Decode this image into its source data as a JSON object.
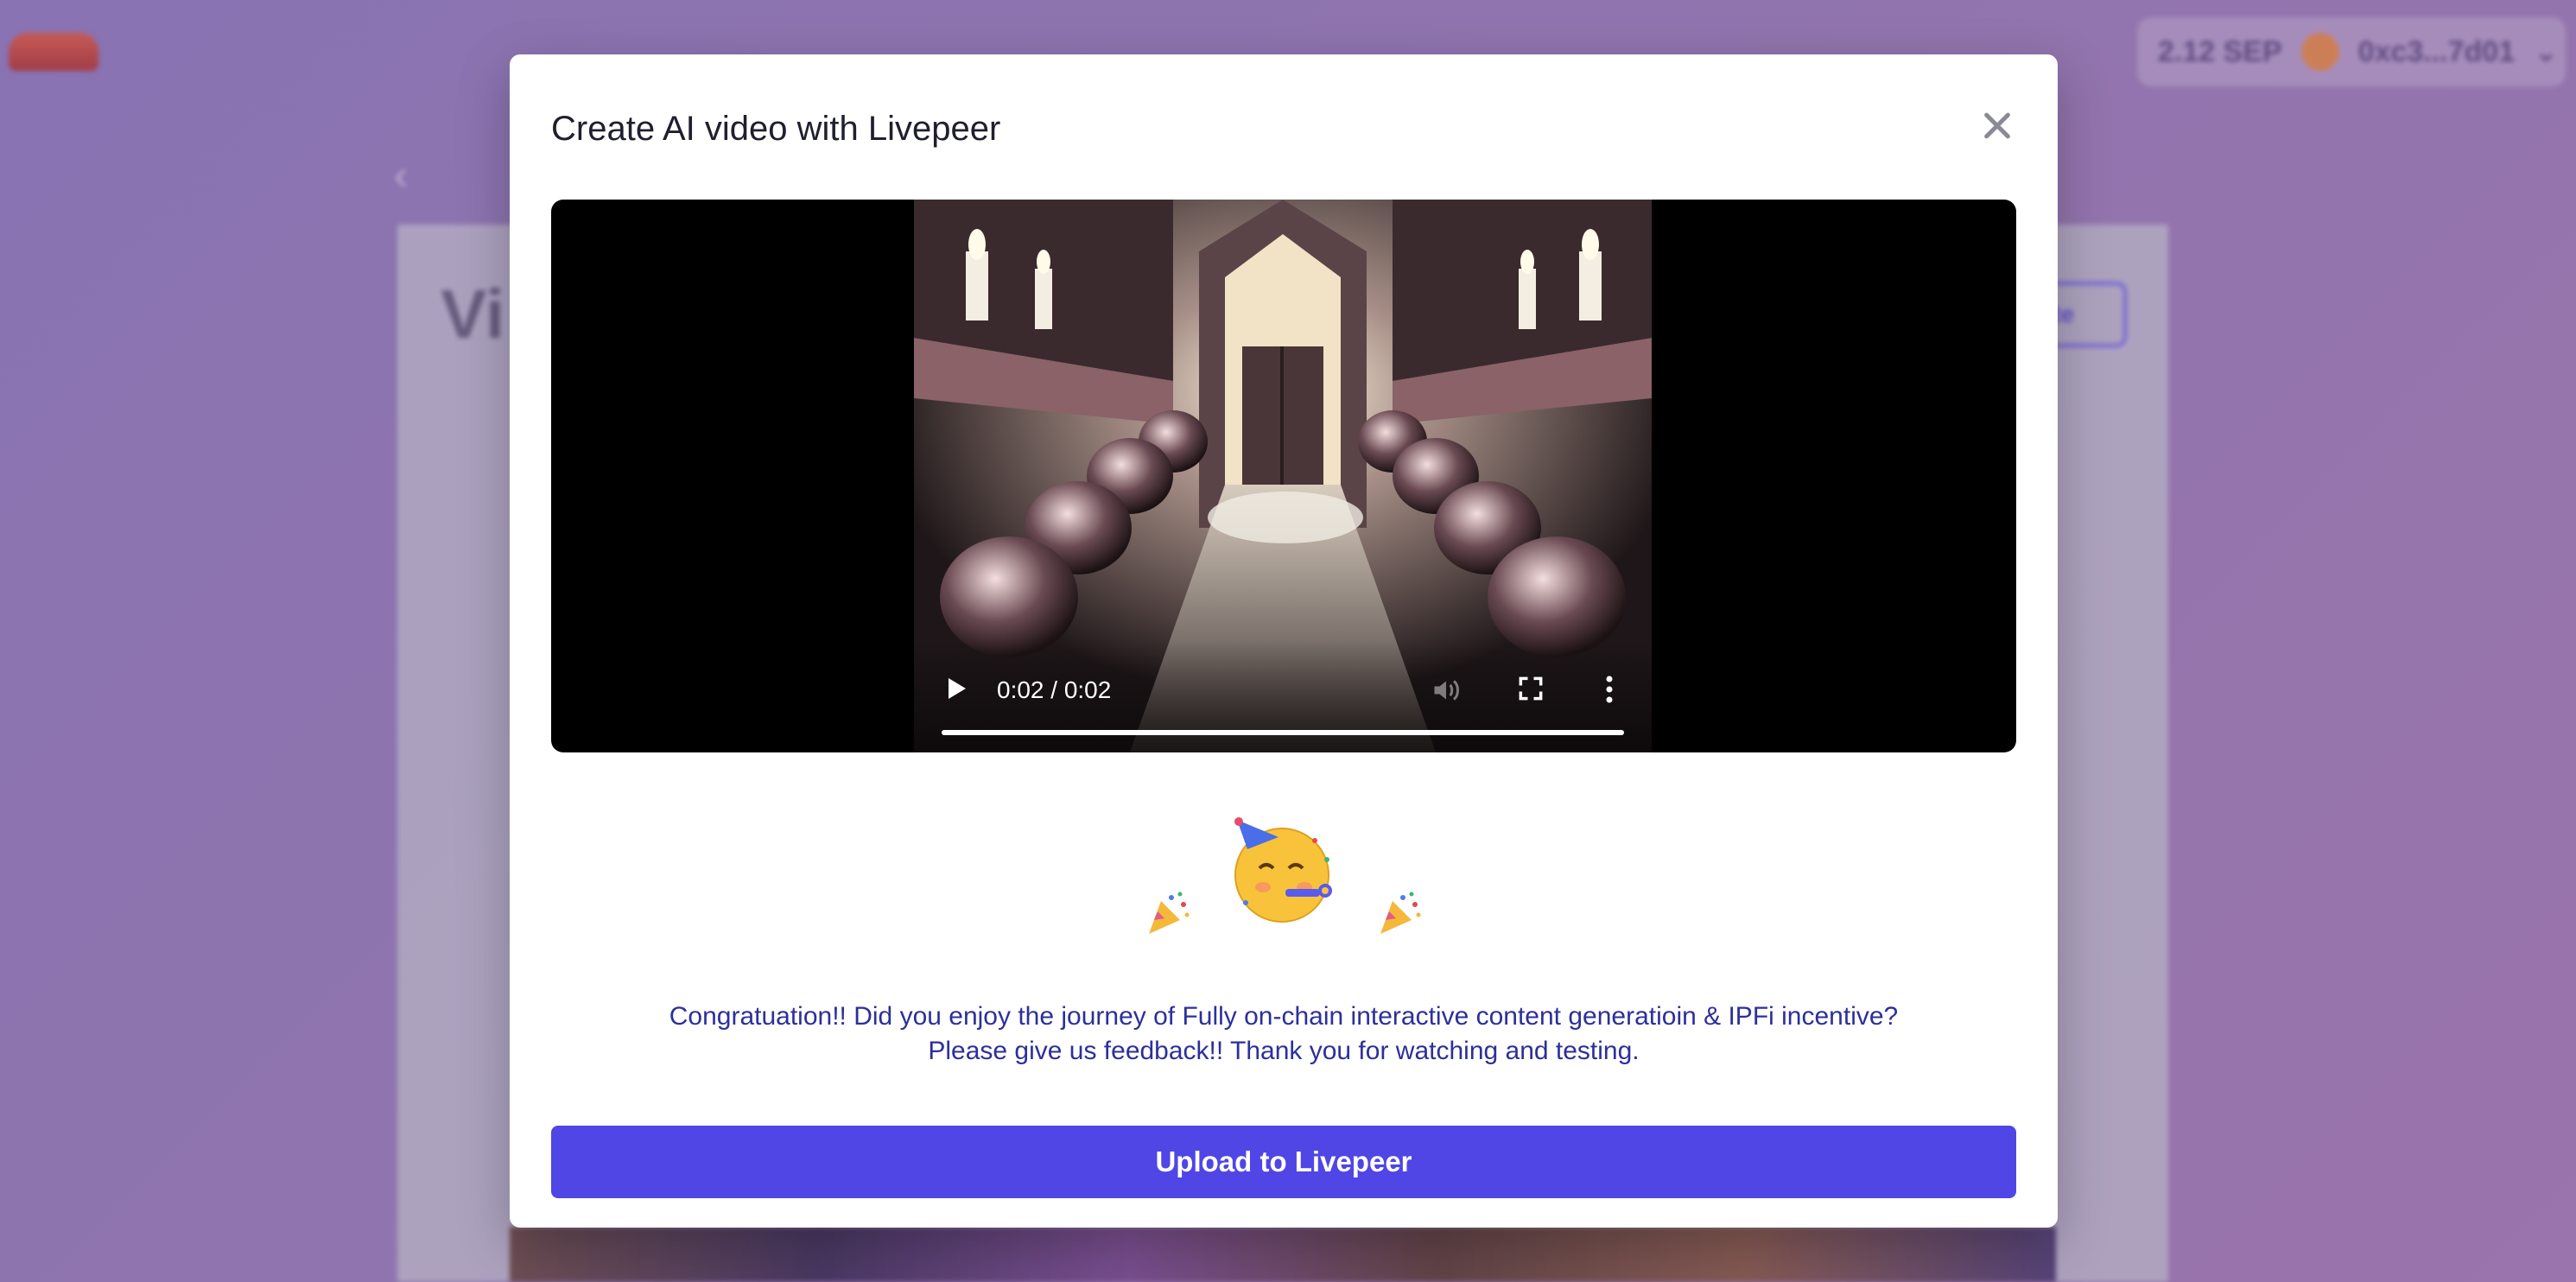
{
  "background": {
    "wallet": {
      "balance": "2.12 SEP",
      "address": "0xc3...7d01"
    },
    "page_title": "Vi",
    "action_button_label": "ate"
  },
  "modal": {
    "title": "Create AI video with Livepeer",
    "video": {
      "time_display": "0:02 / 0:02",
      "progress": 1.0
    },
    "celebration_icons": [
      "face-with-party-horn-icon",
      "party-popper-icon",
      "party-popper-icon"
    ],
    "message": "Congratuation!! Did you enjoy the journey of Fully on-chain interactive content generatioin & IPFi incentive? Please give us feedback!! Thank you for watching and testing.",
    "upload_button_label": "Upload to Livepeer"
  },
  "colors": {
    "accent": "#4f46e5",
    "message_text": "#2d2f9a"
  }
}
